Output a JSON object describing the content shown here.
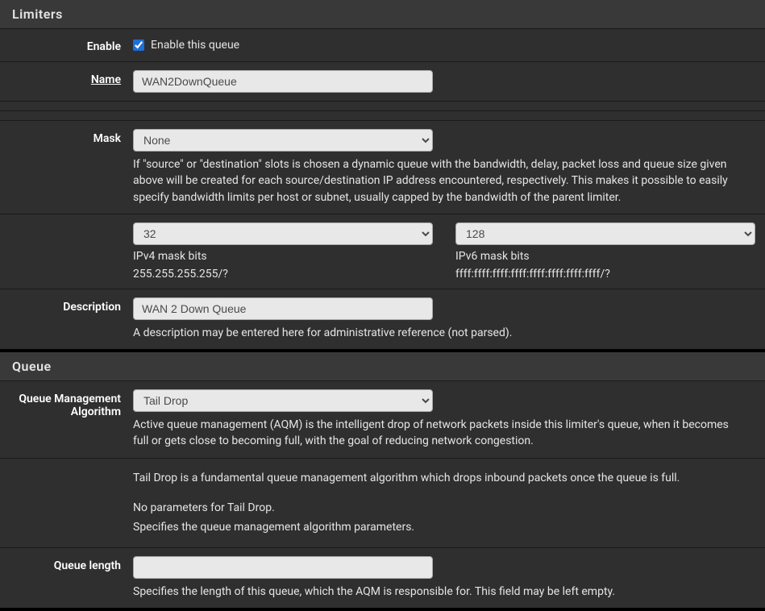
{
  "panel1": {
    "title": "Limiters",
    "enable": {
      "label": "Enable",
      "checkbox_label": "Enable this queue",
      "checked": true
    },
    "name": {
      "label": "Name",
      "value": "WAN2DownQueue"
    },
    "mask": {
      "label": "Mask",
      "selected": "None",
      "help": "If \"source\" or \"destination\" slots is chosen a dynamic queue with the bandwidth, delay, packet loss and queue size given above will be created for each source/destination IP address encountered, respectively. This makes it possible to easily specify bandwidth limits per host or subnet, usually capped by the bandwidth of the parent limiter.",
      "ipv4_bits": "32",
      "ipv4_label": "IPv4 mask bits",
      "ipv4_sub": "255.255.255.255/?",
      "ipv6_bits": "128",
      "ipv6_label": "IPv6 mask bits",
      "ipv6_sub": "ffff:ffff:ffff:ffff:ffff:ffff:ffff:ffff/?"
    },
    "description": {
      "label": "Description",
      "value": "WAN 2 Down Queue",
      "help": "A description may be entered here for administrative reference (not parsed)."
    }
  },
  "panel2": {
    "title": "Queue",
    "qma": {
      "label": "Queue Management Algorithm",
      "selected": "Tail Drop",
      "help": "Active queue management (AQM) is the intelligent drop of network packets inside this limiter's queue, when it becomes full or gets close to becoming full, with the goal of reducing network congestion."
    },
    "body1": "Tail Drop is a fundamental queue management algorithm which drops inbound packets once the queue is full.",
    "params_none": "No parameters for Tail Drop.",
    "params_help": "Specifies the queue management algorithm parameters.",
    "qlen": {
      "label": "Queue length",
      "value": "",
      "help": "Specifies the length of this queue, which the AQM is responsible for. This field may be left empty."
    }
  }
}
